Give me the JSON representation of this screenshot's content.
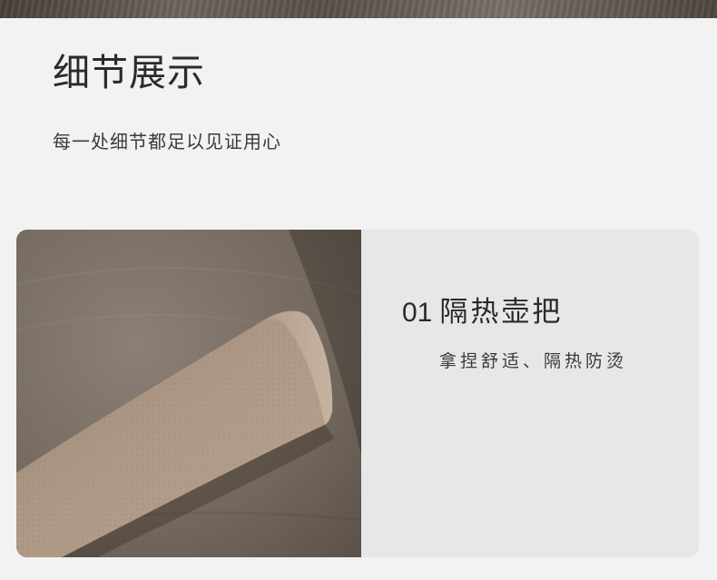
{
  "section": {
    "title": "细节展示",
    "subtitle": "每一处细节都足以见证用心"
  },
  "feature": {
    "number": "01",
    "name": "隔热壶把",
    "description": "拿捏舒适、隔热防烫"
  },
  "colors": {
    "background": "#f2f2f2",
    "card": "#e7e7e7",
    "handle": "#a7917f",
    "text": "#2a2a2a"
  }
}
